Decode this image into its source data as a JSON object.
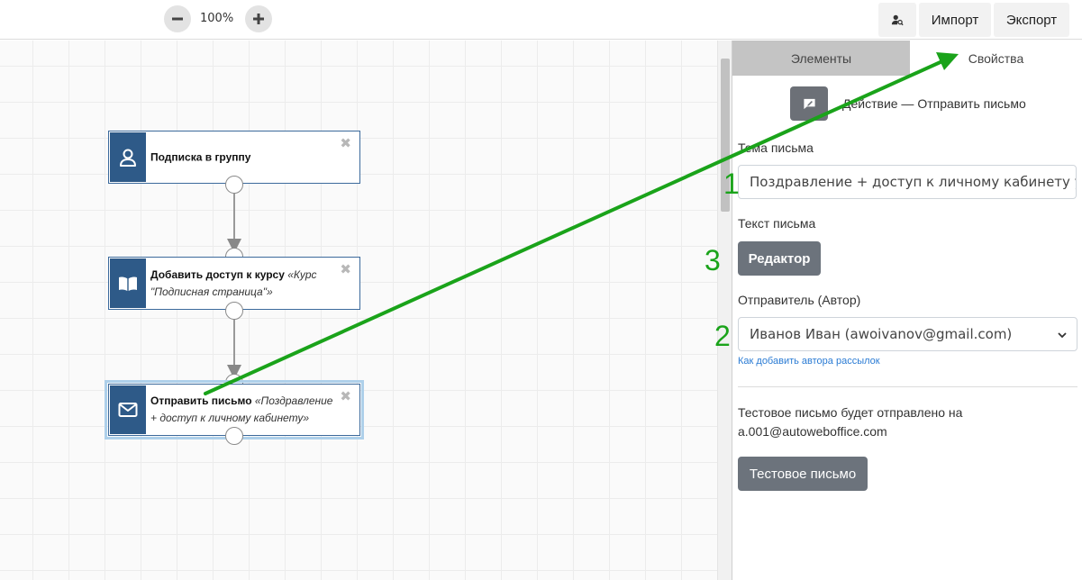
{
  "toolbar": {
    "zoom_level": "100%",
    "zoom_out_icon": "minus-icon",
    "zoom_in_icon": "plus-icon",
    "user_search_icon": "user-search-icon",
    "import_label": "Импорт",
    "export_label": "Экспорт"
  },
  "nodes": [
    {
      "icon": "user-icon",
      "title": "Подписка в группу",
      "detail": ""
    },
    {
      "icon": "book-icon",
      "title": "Добавить доступ к курсу",
      "detail": "«Курс \"Подписная страница\"»"
    },
    {
      "icon": "envelope-icon",
      "title": "Отправить письмо",
      "detail": "«Поздравление + доступ к личному кабинету»"
    }
  ],
  "panel": {
    "tabs": [
      {
        "label": "Элементы",
        "active": false
      },
      {
        "label": "Свойства",
        "active": true
      }
    ],
    "action_icon": "comment-edit-icon",
    "action_title": "Действие — Отправить письмо",
    "subject_label": "Тема письма",
    "subject_value": "Поздравление + доступ к личному кабинету ученика",
    "body_label": "Текст письма",
    "editor_button": "Редактор",
    "sender_label": "Отправитель (Автор)",
    "sender_value": "Иванов Иван (awoivanov@gmail.com)",
    "add_author_link": "Как добавить автора рассылок",
    "test_info": "Тестовое письмо будет отправлено на a.001@autoweboffice.com",
    "test_button": "Тестовое письмо"
  },
  "annotations": [
    "1",
    "2",
    "3"
  ],
  "colors": {
    "node_icon_bg": "#2e5a88",
    "button_gray": "#6c737c",
    "annotation_green": "#1aa31a",
    "link_blue": "#2a7bd4"
  }
}
